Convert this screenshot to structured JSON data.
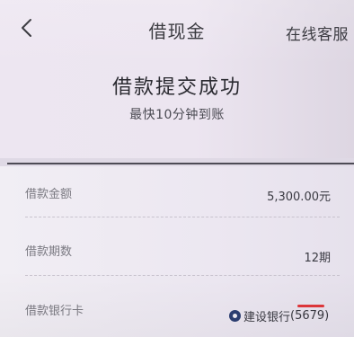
{
  "header": {
    "back_icon": "chevron-left-icon",
    "title": "借现金",
    "service_label": "在线客服"
  },
  "status": {
    "title": "借款提交成功",
    "subtitle": "最快10分钟到账"
  },
  "details": {
    "amount": {
      "label": "借款金额",
      "value": "5,300.00元"
    },
    "term": {
      "label": "借款期数",
      "value": "12期"
    },
    "bank_card": {
      "label": "借款银行卡",
      "bank_icon": "ccb-bank-logo-icon",
      "bank_name": "建设银行",
      "card_suffix": "(5679)"
    }
  },
  "colors": {
    "background": "#ede8f1",
    "text_primary": "#2a2a30",
    "text_secondary": "#7b7a82",
    "divider": "#4d4b55",
    "redaction": "#e0373b",
    "bank_logo": "#2c3e72"
  }
}
